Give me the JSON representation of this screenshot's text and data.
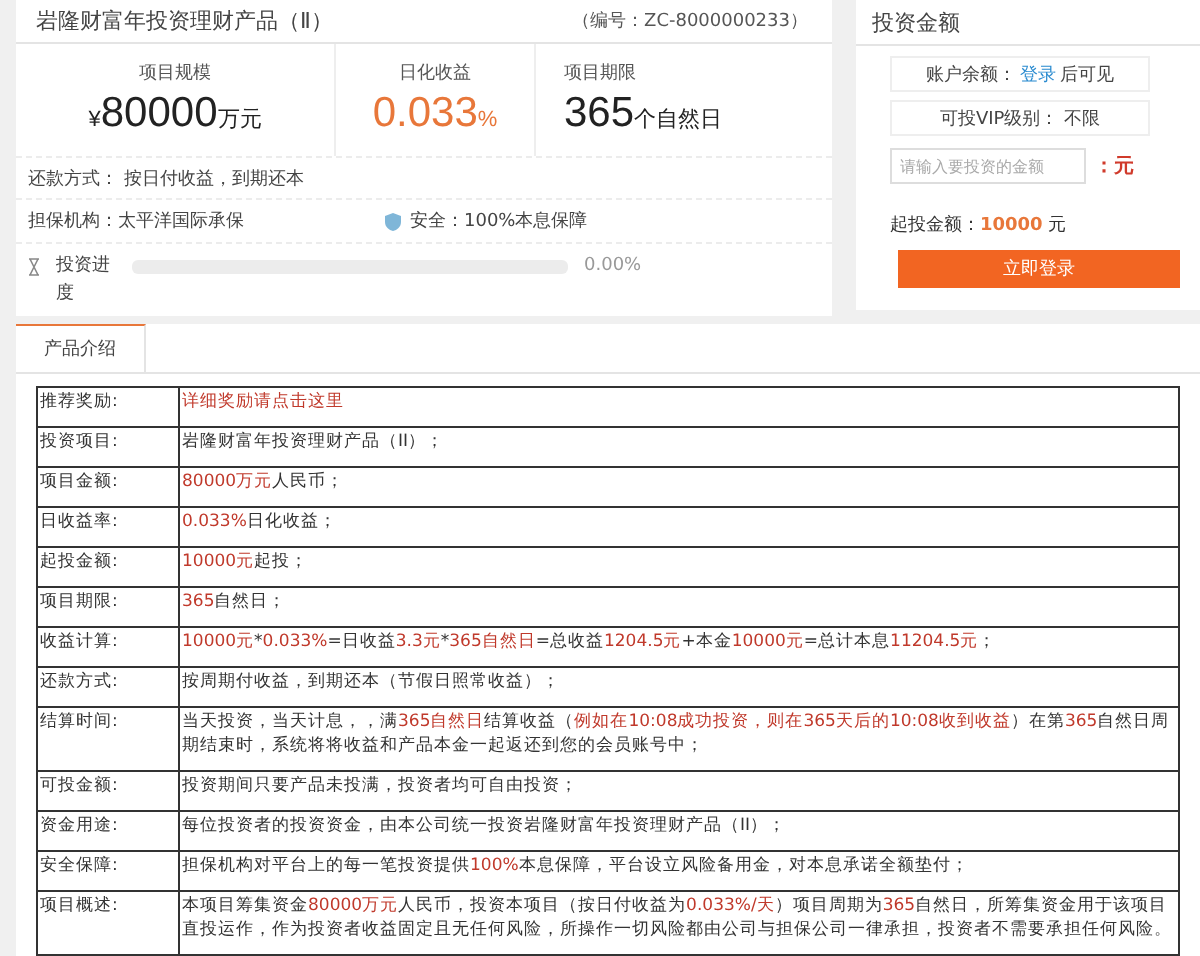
{
  "product": {
    "title": "岩隆财富年投资理财产品（Ⅱ）",
    "code": "（编号：ZC-8000000233）",
    "stats": [
      {
        "label": "项目规模",
        "prefix": "¥",
        "value": "80000",
        "unit": "万元",
        "kind": "plain"
      },
      {
        "label": "日化收益",
        "value": "0.033",
        "unit": "%",
        "kind": "accent"
      },
      {
        "label": "项目期限",
        "value": "365",
        "unit": "个自然日",
        "kind": "plain"
      }
    ],
    "repayment": "还款方式： 按日付收益，到期还本",
    "guarantor": "担保机构：太平洋国际承保",
    "safety": "安全：100%本息保障",
    "progress": {
      "label": "投资进度",
      "level": 0,
      "reading": "0.00%"
    }
  },
  "invest": {
    "title": "投资金额",
    "balance_label": "账户余额：",
    "login_link": "登录",
    "balance_suffix": "后可见",
    "vip": "可投VIP级别： 不限",
    "amount_placeholder": "请输入要投资的金额",
    "amount_unit": "：元",
    "min_label": "起投金额：",
    "min_value": "10000",
    "min_unit": "元",
    "button": "立即登录"
  },
  "tabs": [
    {
      "label": "产品介绍",
      "selected": true
    }
  ],
  "table": [
    {
      "label": "推荐奖励:",
      "segments": [
        {
          "text": "详细奖励请点击这里",
          "highlight": true
        }
      ]
    },
    {
      "label": "投资项目:",
      "segments": [
        {
          "text": "岩隆财富年投资理财产品（II）；",
          "highlight": false
        }
      ]
    },
    {
      "label": "项目金额:",
      "segments": [
        {
          "text": "80000万元",
          "highlight": true
        },
        {
          "text": "人民币；",
          "highlight": false
        }
      ]
    },
    {
      "label": "日收益率:",
      "segments": [
        {
          "text": "0.033%",
          "highlight": true
        },
        {
          "text": "日化收益；",
          "highlight": false
        }
      ]
    },
    {
      "label": "起投金额:",
      "segments": [
        {
          "text": "10000元",
          "highlight": true
        },
        {
          "text": "起投；",
          "highlight": false
        }
      ]
    },
    {
      "label": "项目期限:",
      "segments": [
        {
          "text": "365",
          "highlight": true
        },
        {
          "text": "自然日；",
          "highlight": false
        }
      ]
    },
    {
      "label": "收益计算:",
      "segments": [
        {
          "text": "10000元",
          "highlight": true
        },
        {
          "text": "*",
          "highlight": false
        },
        {
          "text": "0.033%",
          "highlight": true
        },
        {
          "text": "=日收益",
          "highlight": false
        },
        {
          "text": "3.3元",
          "highlight": true
        },
        {
          "text": "*",
          "highlight": false
        },
        {
          "text": "365自然日",
          "highlight": true
        },
        {
          "text": "=总收益",
          "highlight": false
        },
        {
          "text": "1204.5元",
          "highlight": true
        },
        {
          "text": "+本金",
          "highlight": false
        },
        {
          "text": "10000元",
          "highlight": true
        },
        {
          "text": "=总计本息",
          "highlight": false
        },
        {
          "text": "11204.5元",
          "highlight": true
        },
        {
          "text": "；",
          "highlight": false
        }
      ]
    },
    {
      "label": "还款方式:",
      "segments": [
        {
          "text": "按周期付收益，到期还本（节假日照常收益）；",
          "highlight": false
        }
      ]
    },
    {
      "label": "结算时间:",
      "segments": [
        {
          "text": "当天投资，当天计息，，满",
          "highlight": false
        },
        {
          "text": "365自然日",
          "highlight": true
        },
        {
          "text": "结算收益（",
          "highlight": false
        },
        {
          "text": "例如在10:08成功投资，则在365天后的10:08收到收益",
          "highlight": true
        },
        {
          "text": "）在第",
          "highlight": false
        },
        {
          "text": "365",
          "highlight": true
        },
        {
          "text": "自然日周期结束时，系统将将收益和产品本金一起返还到您的会员账号中；",
          "highlight": false
        }
      ]
    },
    {
      "label": "可投金额:",
      "segments": [
        {
          "text": "投资期间只要产品未投满，投资者均可自由投资；",
          "highlight": false
        }
      ]
    },
    {
      "label": "资金用途:",
      "segments": [
        {
          "text": "每位投资者的投资资金，由本公司统一投资岩隆财富年投资理财产品（II）；",
          "highlight": false
        }
      ]
    },
    {
      "label": "安全保障:",
      "segments": [
        {
          "text": "担保机构对平台上的每一笔投资提供",
          "highlight": false
        },
        {
          "text": "100%",
          "highlight": true
        },
        {
          "text": "本息保障，平台设立风险备用金，对本息承诺全额垫付；",
          "highlight": false
        }
      ]
    },
    {
      "label": "项目概述:",
      "segments": [
        {
          "text": "本项目筹集资金",
          "highlight": false
        },
        {
          "text": "80000万元",
          "highlight": true
        },
        {
          "text": "人民币，投资本项目（按日付收益为",
          "highlight": false
        },
        {
          "text": "0.033%/天",
          "highlight": true
        },
        {
          "text": "）项目周期为",
          "highlight": false
        },
        {
          "text": "365",
          "highlight": true
        },
        {
          "text": "自然日，所筹集资金用于该项目直投运作，作为投资者收益固定且无任何风险，所操作一切风险都由公司与担保公司一律承担，投资者不需要承担任何风险。",
          "highlight": false
        }
      ]
    }
  ]
}
